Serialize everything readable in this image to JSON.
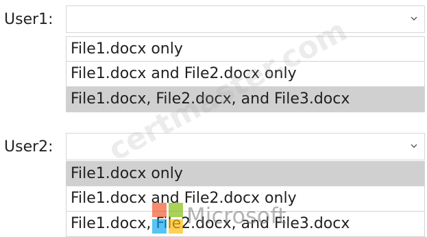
{
  "user1": {
    "label": "User1:",
    "selected_value": "",
    "options": [
      {
        "label": "File1.docx only",
        "highlighted": false
      },
      {
        "label": "File1.docx and File2.docx only",
        "highlighted": false
      },
      {
        "label": "File1.docx, File2.docx, and File3.docx",
        "highlighted": true
      }
    ]
  },
  "user2": {
    "label": "User2:",
    "selected_value": "",
    "options": [
      {
        "label": "File1.docx only",
        "highlighted": true
      },
      {
        "label": "File1.docx and File2.docx only",
        "highlighted": false
      },
      {
        "label": "File1.docx, File2.docx, and File3.docx",
        "highlighted": false
      }
    ]
  },
  "watermark": {
    "site_text": "certmaster.com",
    "brand_text": "Microsoft"
  },
  "icons": {
    "dropdown": "chevron-down-icon",
    "brand": "microsoft-logo-icon"
  },
  "colors": {
    "highlight": "#d0d0d0",
    "border": "#d3d3d3",
    "ms_red": "#f25022",
    "ms_green": "#7fba00",
    "ms_blue": "#00a4ef",
    "ms_yellow": "#ffb900"
  }
}
